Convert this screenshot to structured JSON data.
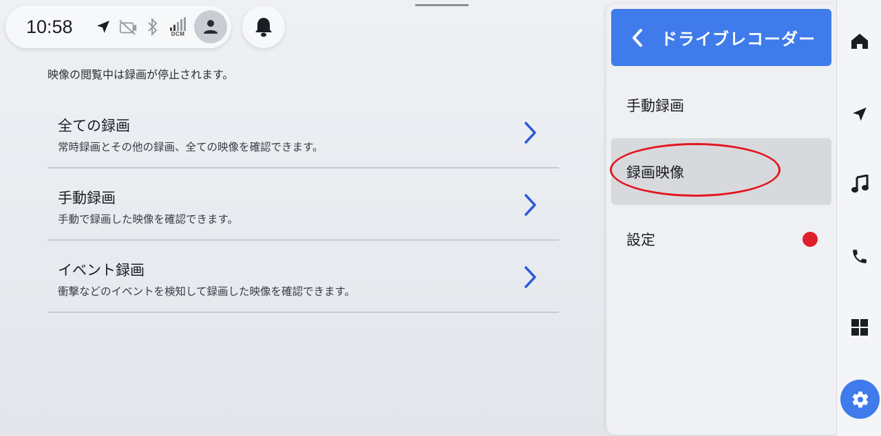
{
  "status_bar": {
    "time": "10:58",
    "dcm_label": "DCM"
  },
  "main": {
    "notice": "映像の閲覧中は録画が停止されます。",
    "items": [
      {
        "title": "全ての録画",
        "description": "常時録画とその他の録画、全ての映像を確認できます。"
      },
      {
        "title": "手動録画",
        "description": "手動で録画した映像を確認できます。"
      },
      {
        "title": "イベント録画",
        "description": "衝撃などのイベントを検知して録画した映像を確認できます。"
      }
    ]
  },
  "panel": {
    "title": "ドライブレコーダー",
    "menu": [
      {
        "label": "手動録画"
      },
      {
        "label": "録画映像"
      },
      {
        "label": "設定"
      }
    ]
  },
  "rail": {
    "icons": [
      "home-icon",
      "navigation-icon",
      "music-icon",
      "phone-icon",
      "apps-icon",
      "settings-icon"
    ]
  },
  "colors": {
    "accent": "#3f7bea",
    "chevron": "#2a5bd7",
    "alert_dot": "#e0202a",
    "annotation": "#e3161e"
  }
}
